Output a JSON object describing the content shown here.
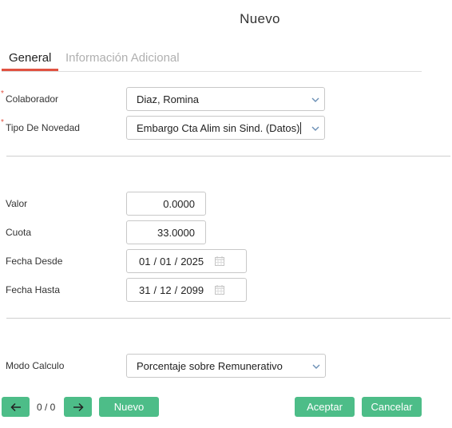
{
  "dialog": {
    "title": "Nuevo"
  },
  "tabs": [
    {
      "label": "General",
      "active": true
    },
    {
      "label": "Información Adicional",
      "active": false
    }
  ],
  "fields": {
    "colaborador": {
      "label": "Colaborador",
      "required": true,
      "value": "Diaz, Romina"
    },
    "tipo_novedad": {
      "label": "Tipo De Novedad",
      "required": true,
      "value": "Embargo Cta Alim sin Sind. (Datos)"
    },
    "valor": {
      "label": "Valor",
      "value": "0.0000"
    },
    "cuota": {
      "label": "Cuota",
      "value": "33.0000"
    },
    "fecha_desde": {
      "label": "Fecha Desde",
      "day": "01",
      "month": "01",
      "year": "2025"
    },
    "fecha_hasta": {
      "label": "Fecha Hasta",
      "day": "31",
      "month": "12",
      "year": "2099"
    },
    "modo_calculo": {
      "label": "Modo Calculo",
      "value": "Porcentaje sobre Remunerativo"
    }
  },
  "required_marker": "*",
  "footer": {
    "counter": "0 / 0",
    "nuevo_label": "Nuevo",
    "aceptar_label": "Aceptar",
    "cancelar_label": "Cancelar"
  },
  "colors": {
    "accent": "#e15241",
    "button": "#4dbd88",
    "inactive_tab": "#b0b0b0"
  },
  "icons": [
    "chevron-down-icon",
    "calendar-icon",
    "arrow-left-icon",
    "arrow-right-icon"
  ]
}
